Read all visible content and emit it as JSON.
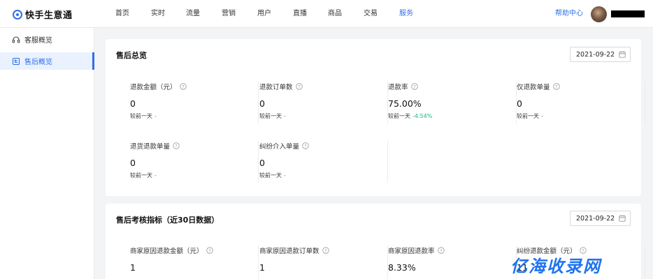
{
  "header": {
    "logo_text": "快手生意通",
    "nav": [
      {
        "label": "首页",
        "active": false
      },
      {
        "label": "实时",
        "active": false
      },
      {
        "label": "流量",
        "active": false
      },
      {
        "label": "营销",
        "active": false
      },
      {
        "label": "用户",
        "active": false
      },
      {
        "label": "直播",
        "active": false
      },
      {
        "label": "商品",
        "active": false
      },
      {
        "label": "交易",
        "active": false
      },
      {
        "label": "服务",
        "active": true
      }
    ],
    "help_label": "帮助中心"
  },
  "sidebar": {
    "items": [
      {
        "label": "客服概览",
        "icon": "headset-icon",
        "active": false
      },
      {
        "label": "售后概览",
        "icon": "return-icon",
        "active": true
      }
    ]
  },
  "after_sales_overview": {
    "title": "售后总览",
    "date": "2021-09-22",
    "metrics": [
      {
        "label": "退款金额（元）",
        "value": "0",
        "compare_label": "较前一天",
        "change": "-"
      },
      {
        "label": "退款订单数",
        "value": "0",
        "compare_label": "较前一天",
        "change": "-"
      },
      {
        "label": "退款率",
        "value": "75.00%",
        "compare_label": "较前一天",
        "change": "-4.54%"
      },
      {
        "label": "仅退款单量",
        "value": "0",
        "compare_label": "较前一天",
        "change": "-"
      },
      {
        "label": "退货退款单量",
        "value": "0",
        "compare_label": "较前一天",
        "change": "-"
      },
      {
        "label": "纠纷介入单量",
        "value": "0",
        "compare_label": "较前一天",
        "change": "-"
      }
    ]
  },
  "after_sales_kpi": {
    "title": "售后考核指标（近30日数据）",
    "date": "2021-09-22",
    "metrics": [
      {
        "label": "商家原因退款金额（元）",
        "value": "1"
      },
      {
        "label": "商家原因退款订单数",
        "value": "1"
      },
      {
        "label": "商家原因退款率",
        "value": "8.33%"
      },
      {
        "label": "纠纷退款金额（元）",
        "value": "11"
      }
    ]
  },
  "watermark": "亿海收录网",
  "colors": {
    "accent": "#2f6fe8",
    "increase": "#e5484d",
    "decrease": "#1cb58a"
  }
}
